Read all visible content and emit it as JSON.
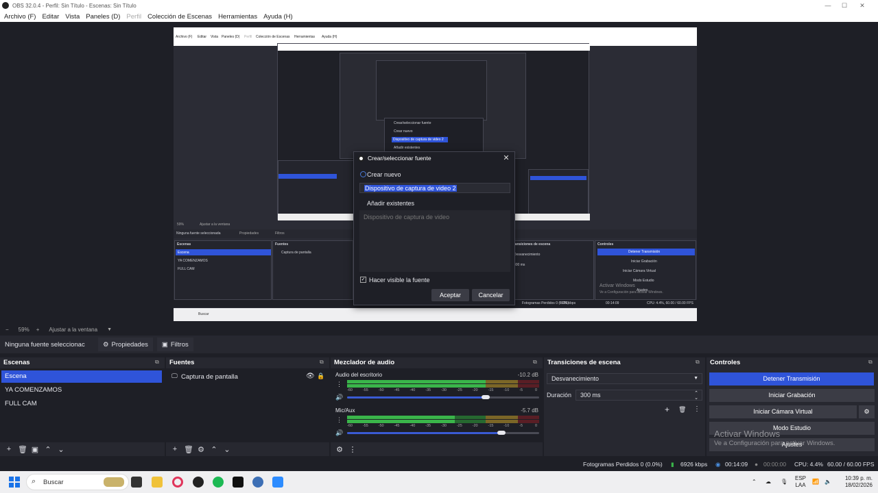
{
  "window": {
    "title": "OBS 32.0.4 - Perfil: Sin Título - Escenas: Sin Título",
    "minimize": "—",
    "maximize": "☐",
    "close": "✕"
  },
  "menu": {
    "items": [
      "Archivo (F)",
      "Editar",
      "Vista",
      "Paneles (D)",
      "Perfil",
      "Colección de Escenas",
      "Herramientas",
      "Ayuda (H)"
    ]
  },
  "nested_preview": {
    "menu_items": [
      "Archivo (F)",
      "Editar",
      "Vista",
      "Paneles (D)",
      "Perfil",
      "Colección de Escenas",
      "Herramientas",
      "Ayuda (H)"
    ],
    "zoom_text": "59%",
    "fit_text": "Ajustar a la ventana",
    "no_source": "Ninguna fuente seleccionada",
    "props": "Propiedades",
    "filters": "Filtros",
    "scenes_title": "Escenas",
    "sources_title": "Fuentes",
    "scenes": [
      "Escena",
      "YA COMENZAMOS",
      "FULL CAM"
    ],
    "source": "Captura de pantalla",
    "transitions_title": "Transiciones de escena",
    "controls_title": "Controles",
    "ctl": [
      "Detener Transmisión",
      "Iniciar Grabación",
      "Iniciar Cámara Virtual",
      "Modo Estudio",
      "Ajustes"
    ],
    "trans_select": "Desvanecimiento",
    "trans_dur": "300 ms",
    "status": "Fotogramas Perdidos 0 (0.0%)",
    "kbps": "6926 kbps",
    "time": "00:14:09",
    "cpu": "CPU: 4.4%, 60.00 / 60.00 FPS",
    "taskbar_search": "Buscar",
    "inner_dialog_title": "Crear/seleccionar fuente",
    "inner_dialog_new": "Crear nuevo",
    "inner_dialog_value": "Dispositivo de captura de video 2",
    "inner_dialog_existing": "Añadir existentes",
    "inner_dialog2_value": "Dispositivo de captura de video",
    "inner_dialog2_header": "Crear nuevo",
    "watermark1": "Activar Windows",
    "watermark2": "Ve a Configuración para activar Windows."
  },
  "dialog": {
    "title": "Crear/seleccionar fuente",
    "create_new_label": "Crear nuevo",
    "new_name_value": "Dispositivo de captura de video 2",
    "add_existing_label": "Añadir existentes",
    "existing_items": [
      "Dispositivo de captura de video"
    ],
    "visible_label": "Hacer visible la fuente",
    "visible_checked": true,
    "accept_label": "Aceptar",
    "cancel_label": "Cancelar"
  },
  "zoom": {
    "minus": "−",
    "value": "59%",
    "plus": "+",
    "fit_label": "Ajustar a la ventana"
  },
  "source_toolbar": {
    "no_source": "Ninguna fuente seleccionac",
    "properties_label": "Propiedades",
    "filters_label": "Filtros"
  },
  "scenes": {
    "title": "Escenas",
    "items": [
      "Escena",
      "YA COMENZAMOS",
      "FULL CAM"
    ],
    "selected_index": 0
  },
  "sources": {
    "title": "Fuentes",
    "items": [
      {
        "name": "Captura de pantalla",
        "visible": true,
        "locked": true
      }
    ]
  },
  "mixer": {
    "title": "Mezclador de audio",
    "tracks": [
      {
        "name": "Audio del escritorio",
        "db": "-10.2 dB",
        "level": 0.72,
        "volume": 0.88
      },
      {
        "name": "Mic/Aux",
        "db": "-5.7 dB",
        "level": 0.56,
        "volume": 0.98
      }
    ],
    "ticks": [
      "-60",
      "-55",
      "-50",
      "-45",
      "-40",
      "-35",
      "-30",
      "-25",
      "-20",
      "-15",
      "-10",
      "-5",
      "0"
    ]
  },
  "transitions": {
    "title": "Transiciones de escena",
    "selected": "Desvanecimiento",
    "duration_label": "Duración",
    "duration_value": "300 ms"
  },
  "controls": {
    "title": "Controles",
    "stop_stream": "Detener Transmisión",
    "start_record": "Iniciar Grabación",
    "start_vcam": "Iniciar Cámara Virtual",
    "studio_mode": "Modo Estudio",
    "settings": "Ajustes"
  },
  "watermark": {
    "line1": "Activar Windows",
    "line2": "Ve a Configuración para activar Windows."
  },
  "status": {
    "dropped": "Fotogramas Perdidos 0 (0.0%)",
    "kbps": "6926 kbps",
    "stream_time": "00:14:09",
    "rec_time": "00:00:00",
    "cpu": "CPU: 4.4%",
    "fps": "60.00 / 60.00 FPS"
  },
  "taskbar": {
    "search_placeholder": "Buscar",
    "lang": "ESP",
    "lang2": "LAA",
    "time": "10:39 p. m.",
    "date": "18/02/2026"
  },
  "colors": {
    "accent": "#2f54d9",
    "bg": "#1e1f26",
    "panel": "#272830",
    "meter_green": "#3ab54a",
    "meter_yellow": "#c8a128",
    "meter_red": "#8a1e24"
  }
}
